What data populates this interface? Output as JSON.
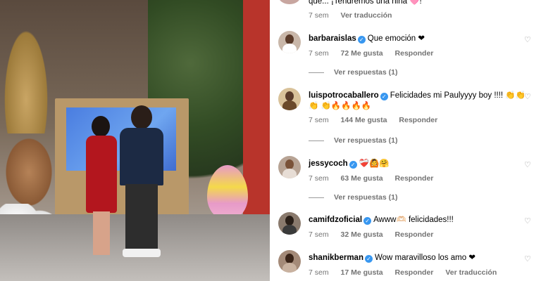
{
  "comments": [
    {
      "text": "que... ¡Tendremos una niña 🩷!",
      "time": "7 sem",
      "likes": "",
      "action": "Ver traducción"
    },
    {
      "username": "barbaraislas",
      "verified": true,
      "text": "Que emoción ❤",
      "time": "7 sem",
      "likes": "72 Me gusta",
      "reply": "Responder",
      "view_replies": "Ver respuestas (1)"
    },
    {
      "username": "luispotrocaballero",
      "verified": true,
      "text": "Felicidades mi Paulyyyy boy !!!! 👏👏👏 👏🔥🔥🔥🔥",
      "time": "7 sem",
      "likes": "144 Me gusta",
      "reply": "Responder",
      "view_replies": "Ver respuestas (1)"
    },
    {
      "username": "jessycoch",
      "verified": true,
      "text": "❤️‍🩹🙆🤗",
      "time": "7 sem",
      "likes": "63 Me gusta",
      "reply": "Responder",
      "view_replies": "Ver respuestas (1)"
    },
    {
      "username": "camifdzoficial",
      "verified": true,
      "text": "Awww🫶🏻 felicidades!!!",
      "time": "7 sem",
      "likes": "32 Me gusta",
      "reply": "Responder"
    },
    {
      "username": "shanikberman",
      "verified": true,
      "text": "Wow maravilloso los amo ❤",
      "time": "7 sem",
      "likes": "17 Me gusta",
      "reply": "Responder",
      "translate": "Ver traducción"
    }
  ],
  "icons": {
    "verified": "verified-badge-icon",
    "like": "heart-outline-icon"
  },
  "colors": {
    "verified": "#3897f0",
    "meta": "#737373",
    "heart": "#ed1c24"
  }
}
